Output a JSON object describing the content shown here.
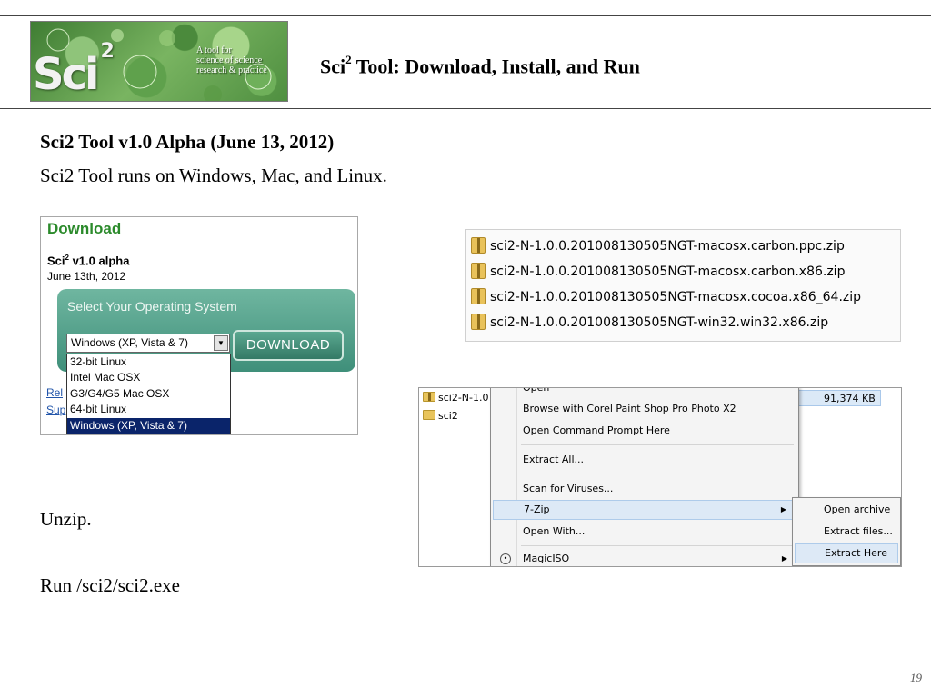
{
  "slide": {
    "title_base": "Sci",
    "title_sup": "2",
    "title_rest": " Tool: Download, Install, and Run",
    "heading": "Sci2 Tool v1.0 Alpha (June 13, 2012)",
    "subline": "Sci2 Tool runs on Windows, Mac, and Linux.",
    "unzip": "Unzip.",
    "run": "Run /sci2/sci2.exe",
    "page_number": "19"
  },
  "logo": {
    "mark": "Sci",
    "mark_sup": "2",
    "tagline_1": "A tool for",
    "tagline_2": "science of science",
    "tagline_3": "research & practice",
    "colors": {
      "bg_dark": "#3f7d33",
      "bg_light": "#a7d58a"
    }
  },
  "download_panel": {
    "title": "Download",
    "version_base": "Sci",
    "version_sup": "2",
    "version_rest": " v1.0 alpha",
    "date": "June 13th, 2012",
    "select_label": "Select Your Operating System",
    "selected_os": "Windows (XP, Vista & 7)",
    "button": "DOWNLOAD",
    "options": [
      "32-bit Linux",
      "Intel Mac OSX",
      "G3/G4/G5 Mac OSX",
      "64-bit Linux",
      "Windows (XP, Vista & 7)"
    ],
    "side_link_1": "Rel",
    "side_link_2": "Sup",
    "colors": {
      "title": "#2b8a2b",
      "panel": "#3f8f7a",
      "selection": "#0a246a"
    }
  },
  "zip_files": [
    "sci2-N-1.0.0.201008130505NGT-macosx.carbon.ppc.zip",
    "sci2-N-1.0.0.201008130505NGT-macosx.carbon.x86.zip",
    "sci2-N-1.0.0.201008130505NGT-macosx.cocoa.x86_64.zip",
    "sci2-N-1.0.0.201008130505NGT-win32.win32.x86.zip"
  ],
  "explorer": {
    "rows": [
      "sci2-N-1.0",
      "sci2"
    ],
    "size": "91,374 KB",
    "context_menu": [
      "Open",
      "Browse with Corel Paint Shop Pro Photo X2",
      "Open Command Prompt Here",
      "Extract All...",
      "Scan for Viruses...",
      "7-Zip",
      "Open With...",
      "MagicISO"
    ],
    "submenu": [
      "Open archive",
      "Extract files...",
      "Extract Here"
    ],
    "colors": {
      "highlight": "#dde9f6"
    }
  }
}
